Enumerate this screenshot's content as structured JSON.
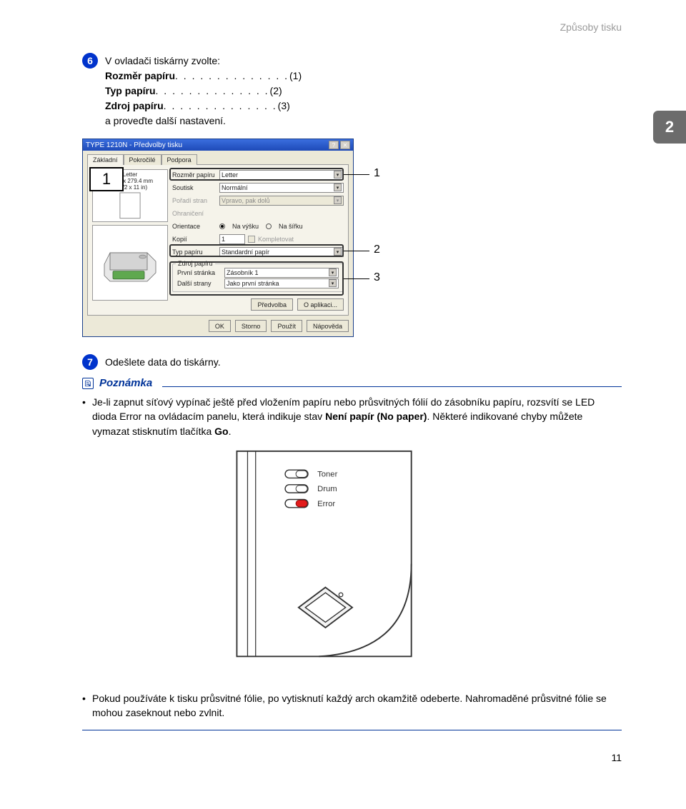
{
  "header": {
    "section": "Způsoby tisku"
  },
  "chapter": "2",
  "step6": {
    "number": "6",
    "intro": "V ovladači tiskárny zvolte:",
    "items": [
      {
        "label": "Rozměr papíru",
        "num": "(1)"
      },
      {
        "label": "Typ papíru",
        "num": "(2)"
      },
      {
        "label": "Zdroj papíru",
        "num": "(3)"
      }
    ],
    "outro": "a proveďte další nastavení."
  },
  "dialog": {
    "title": "TYPE 1210N - Předvolby tisku",
    "tabs": [
      "Základní",
      "Pokročilé",
      "Podpora"
    ],
    "preview": {
      "name": "Letter",
      "dim1": "215.9 x 279.4 mm",
      "dim2": "(8 1/2 x 11 in)"
    },
    "controls": {
      "rozmer_lbl": "Rozměr papíru",
      "rozmer_val": "Letter",
      "soutisk_lbl": "Soutisk",
      "soutisk_val": "Normální",
      "poradi_lbl": "Pořadí stran",
      "poradi_val": "Vpravo, pak dolů",
      "ohran_lbl": "Ohraničení",
      "orient_lbl": "Orientace",
      "orient_a": "Na výšku",
      "orient_b": "Na šířku",
      "kopii_lbl": "Kopií",
      "kopii_val": "1",
      "komplet_lbl": "Kompletovat",
      "typ_lbl": "Typ papíru",
      "typ_val": "Standardní papír",
      "zdroj_lbl": "Zdroj papíru",
      "prvni_lbl": "První stránka",
      "prvni_val": "Zásobník 1",
      "dalsi_lbl": "Další strany",
      "dalsi_val": "Jako první stránka"
    },
    "buttons_inner": [
      "Předvolba",
      "O aplikaci..."
    ],
    "buttons_outer": [
      "OK",
      "Storno",
      "Použít",
      "Nápověda"
    ]
  },
  "callouts": {
    "big": "1",
    "c1": "1",
    "c2": "2",
    "c3": "3"
  },
  "step7": {
    "number": "7",
    "text": "Odešlete data do tiskárny."
  },
  "note": {
    "title": "Poznámka",
    "b1a": "Je-li zapnut síťový vypínač ještě před vložením papíru nebo průsvitných fólií do zásobníku papíru, rozsvítí se LED dioda Error na ovládacím panelu, která indikuje stav ",
    "b1b": "Není papír (No paper)",
    "b1c": ". Některé indikované chyby můžete vymazat stisknutím tlačítka ",
    "b1d": "Go",
    "b1e": ".",
    "leds": {
      "toner": "Toner",
      "drum": "Drum",
      "error": "Error"
    },
    "b2": "Pokud používáte k tisku průsvitné fólie, po vytisknutí každý arch okamžitě odeberte. Nahromaděné průsvitné fólie se mohou zaseknout nebo zvlnit."
  },
  "page": "11"
}
